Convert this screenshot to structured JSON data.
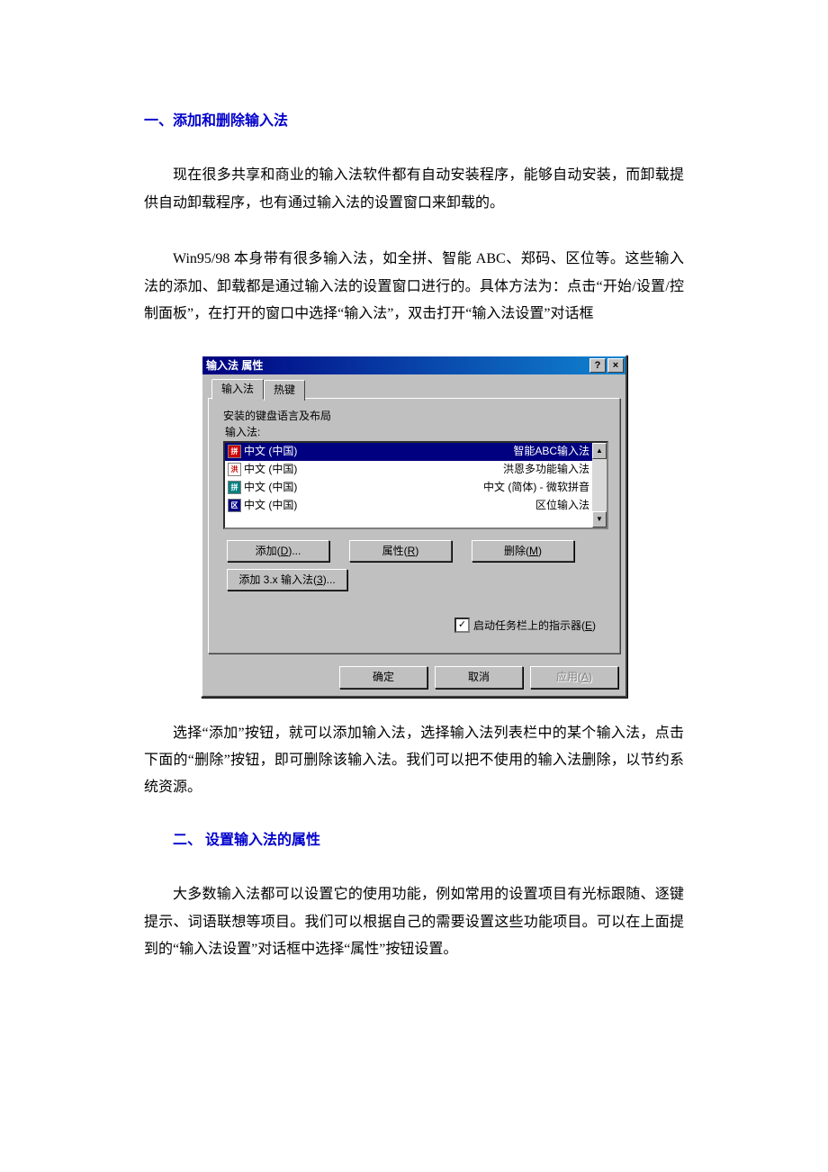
{
  "heading1": "一、添加和删除输入法",
  "para1": "现在很多共享和商业的输入法软件都有自动安装程序，能够自动安装，而卸载提供自动卸载程序，也有通过输入法的设置窗口来卸载的。",
  "para2": "Win95/98 本身带有很多输入法，如全拼、智能 ABC、郑码、区位等。这些输入法的添加、卸载都是通过输入法的设置窗口进行的。具体方法为：点击“开始/设置/控制面板”，在打开的窗口中选择“输入法”，双击打开“输入法设置”对话框",
  "dialog": {
    "title": "输入法 属性",
    "tab_active": "输入法",
    "tab_inactive": "热键",
    "group_label": "安装的键盘语言及布局",
    "list_label": "输入法:",
    "rows": [
      {
        "lang": "中文 (中国)",
        "ime": "智能ABC输入法"
      },
      {
        "lang": "中文 (中国)",
        "ime": "洪恩多功能输入法"
      },
      {
        "lang": "中文 (中国)",
        "ime": "中文  (简体) - 微软拼音"
      },
      {
        "lang": "中文 (中国)",
        "ime": "区位输入法"
      }
    ],
    "btn_add": "添加(D)...",
    "btn_props": "属性(R)",
    "btn_delete": "删除(M)",
    "btn_add3x": "添加 3.x 输入法(3)...",
    "chk_indicator": "启动任务栏上的指示器(E)",
    "btn_ok": "确定",
    "btn_cancel": "取消",
    "btn_apply": "应用(A)"
  },
  "para3": "选择“添加”按钮，就可以添加输入法，选择输入法列表栏中的某个输入法，点击下面的“删除”按钮，即可删除该输入法。我们可以把不使用的输入法删除，以节约系统资源。",
  "heading2": "二、 设置输入法的属性",
  "para4": "大多数输入法都可以设置它的使用功能，例如常用的设置项目有光标跟随、逐键提示、词语联想等项目。我们可以根据自己的需要设置这些功能项目。可以在上面提到的“输入法设置”对话框中选择“属性”按钮设置。"
}
